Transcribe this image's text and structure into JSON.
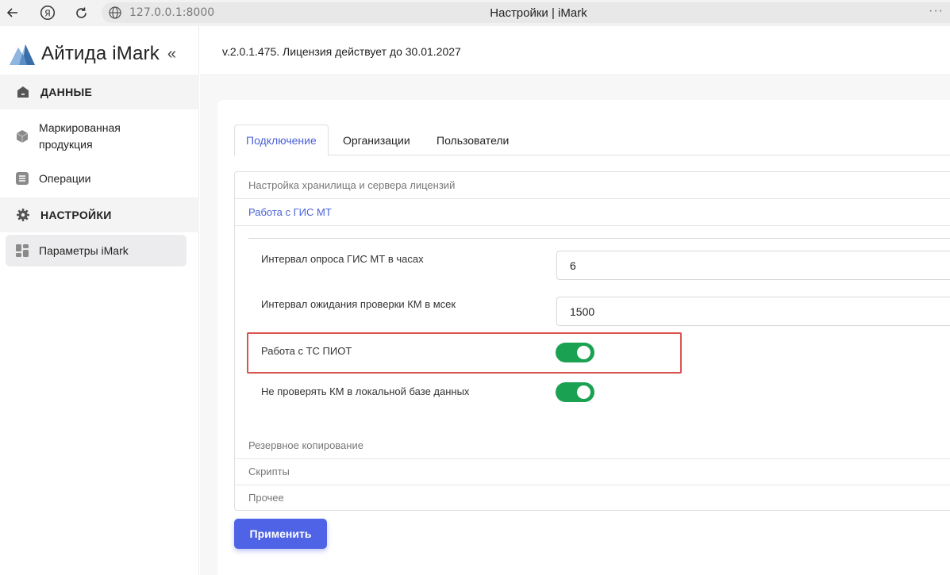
{
  "browser": {
    "url": "127.0.0.1:8000",
    "title": "Настройки | iMark",
    "more": "···"
  },
  "sidebar": {
    "brand": "Айтида iMark",
    "collapse_glyph": "«",
    "sections": [
      {
        "label": "ДАННЫЕ",
        "icon": "database-icon"
      },
      {
        "label": "НАСТРОЙКИ",
        "icon": "gear-icon"
      }
    ],
    "items": [
      {
        "label": "Маркированная продукция",
        "icon": "box-icon"
      },
      {
        "label": "Операции",
        "icon": "list-icon"
      },
      {
        "label": "Параметры iMark",
        "icon": "dashboard-icon",
        "active": true
      }
    ]
  },
  "header": {
    "version": "v.2.0.1.475. Лицензия действует до 30.01.2027"
  },
  "tabs": [
    {
      "label": "Подключение",
      "active": true
    },
    {
      "label": "Организации"
    },
    {
      "label": "Пользователи"
    }
  ],
  "accordion": {
    "storage": "Настройка хранилища и сервера лицензий",
    "gis": "Работа с ГИС МТ",
    "backup": "Резервное копирование",
    "scripts": "Скрипты",
    "other": "Прочее"
  },
  "fields": {
    "poll_interval_label": "Интервал опроса ГИС МТ в часах",
    "poll_interval_value": "6",
    "check_timeout_label": "Интервал ожидания проверки КМ в мсек",
    "check_timeout_value": "1500",
    "tc_piot_label": "Работа с ТС ПИОТ",
    "tc_piot_on": true,
    "skip_local_label": "Не проверять КМ в локальной базе данных",
    "skip_local_on": true
  },
  "actions": {
    "apply": "Применить"
  },
  "colors": {
    "accent": "#4a62d8",
    "toggle_on": "#1aa152",
    "highlight": "#d9534f",
    "button": "#4f63e6"
  }
}
